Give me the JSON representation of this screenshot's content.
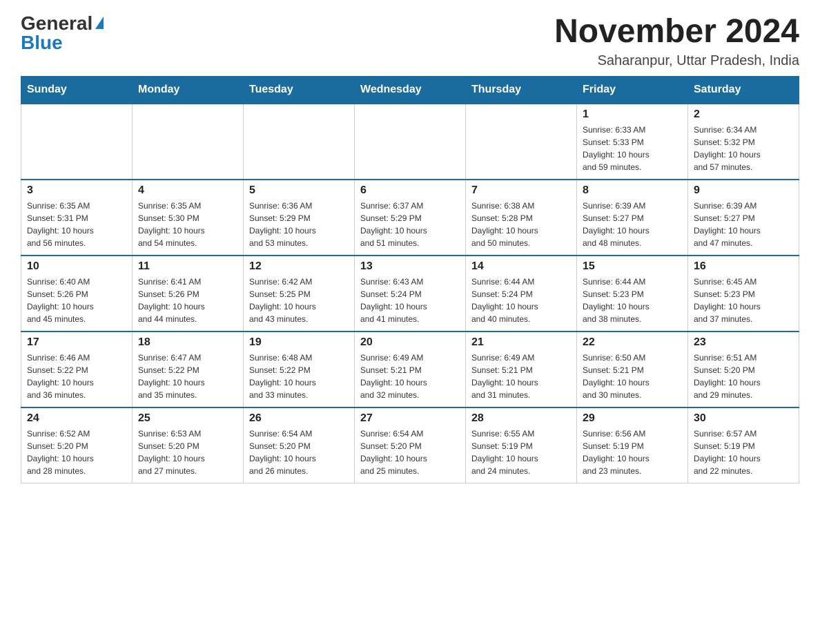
{
  "header": {
    "logo_general": "General",
    "logo_blue": "Blue",
    "month_title": "November 2024",
    "location": "Saharanpur, Uttar Pradesh, India"
  },
  "days_of_week": [
    "Sunday",
    "Monday",
    "Tuesday",
    "Wednesday",
    "Thursday",
    "Friday",
    "Saturday"
  ],
  "weeks": [
    [
      {
        "day": "",
        "info": ""
      },
      {
        "day": "",
        "info": ""
      },
      {
        "day": "",
        "info": ""
      },
      {
        "day": "",
        "info": ""
      },
      {
        "day": "",
        "info": ""
      },
      {
        "day": "1",
        "info": "Sunrise: 6:33 AM\nSunset: 5:33 PM\nDaylight: 10 hours\nand 59 minutes."
      },
      {
        "day": "2",
        "info": "Sunrise: 6:34 AM\nSunset: 5:32 PM\nDaylight: 10 hours\nand 57 minutes."
      }
    ],
    [
      {
        "day": "3",
        "info": "Sunrise: 6:35 AM\nSunset: 5:31 PM\nDaylight: 10 hours\nand 56 minutes."
      },
      {
        "day": "4",
        "info": "Sunrise: 6:35 AM\nSunset: 5:30 PM\nDaylight: 10 hours\nand 54 minutes."
      },
      {
        "day": "5",
        "info": "Sunrise: 6:36 AM\nSunset: 5:29 PM\nDaylight: 10 hours\nand 53 minutes."
      },
      {
        "day": "6",
        "info": "Sunrise: 6:37 AM\nSunset: 5:29 PM\nDaylight: 10 hours\nand 51 minutes."
      },
      {
        "day": "7",
        "info": "Sunrise: 6:38 AM\nSunset: 5:28 PM\nDaylight: 10 hours\nand 50 minutes."
      },
      {
        "day": "8",
        "info": "Sunrise: 6:39 AM\nSunset: 5:27 PM\nDaylight: 10 hours\nand 48 minutes."
      },
      {
        "day": "9",
        "info": "Sunrise: 6:39 AM\nSunset: 5:27 PM\nDaylight: 10 hours\nand 47 minutes."
      }
    ],
    [
      {
        "day": "10",
        "info": "Sunrise: 6:40 AM\nSunset: 5:26 PM\nDaylight: 10 hours\nand 45 minutes."
      },
      {
        "day": "11",
        "info": "Sunrise: 6:41 AM\nSunset: 5:26 PM\nDaylight: 10 hours\nand 44 minutes."
      },
      {
        "day": "12",
        "info": "Sunrise: 6:42 AM\nSunset: 5:25 PM\nDaylight: 10 hours\nand 43 minutes."
      },
      {
        "day": "13",
        "info": "Sunrise: 6:43 AM\nSunset: 5:24 PM\nDaylight: 10 hours\nand 41 minutes."
      },
      {
        "day": "14",
        "info": "Sunrise: 6:44 AM\nSunset: 5:24 PM\nDaylight: 10 hours\nand 40 minutes."
      },
      {
        "day": "15",
        "info": "Sunrise: 6:44 AM\nSunset: 5:23 PM\nDaylight: 10 hours\nand 38 minutes."
      },
      {
        "day": "16",
        "info": "Sunrise: 6:45 AM\nSunset: 5:23 PM\nDaylight: 10 hours\nand 37 minutes."
      }
    ],
    [
      {
        "day": "17",
        "info": "Sunrise: 6:46 AM\nSunset: 5:22 PM\nDaylight: 10 hours\nand 36 minutes."
      },
      {
        "day": "18",
        "info": "Sunrise: 6:47 AM\nSunset: 5:22 PM\nDaylight: 10 hours\nand 35 minutes."
      },
      {
        "day": "19",
        "info": "Sunrise: 6:48 AM\nSunset: 5:22 PM\nDaylight: 10 hours\nand 33 minutes."
      },
      {
        "day": "20",
        "info": "Sunrise: 6:49 AM\nSunset: 5:21 PM\nDaylight: 10 hours\nand 32 minutes."
      },
      {
        "day": "21",
        "info": "Sunrise: 6:49 AM\nSunset: 5:21 PM\nDaylight: 10 hours\nand 31 minutes."
      },
      {
        "day": "22",
        "info": "Sunrise: 6:50 AM\nSunset: 5:21 PM\nDaylight: 10 hours\nand 30 minutes."
      },
      {
        "day": "23",
        "info": "Sunrise: 6:51 AM\nSunset: 5:20 PM\nDaylight: 10 hours\nand 29 minutes."
      }
    ],
    [
      {
        "day": "24",
        "info": "Sunrise: 6:52 AM\nSunset: 5:20 PM\nDaylight: 10 hours\nand 28 minutes."
      },
      {
        "day": "25",
        "info": "Sunrise: 6:53 AM\nSunset: 5:20 PM\nDaylight: 10 hours\nand 27 minutes."
      },
      {
        "day": "26",
        "info": "Sunrise: 6:54 AM\nSunset: 5:20 PM\nDaylight: 10 hours\nand 26 minutes."
      },
      {
        "day": "27",
        "info": "Sunrise: 6:54 AM\nSunset: 5:20 PM\nDaylight: 10 hours\nand 25 minutes."
      },
      {
        "day": "28",
        "info": "Sunrise: 6:55 AM\nSunset: 5:19 PM\nDaylight: 10 hours\nand 24 minutes."
      },
      {
        "day": "29",
        "info": "Sunrise: 6:56 AM\nSunset: 5:19 PM\nDaylight: 10 hours\nand 23 minutes."
      },
      {
        "day": "30",
        "info": "Sunrise: 6:57 AM\nSunset: 5:19 PM\nDaylight: 10 hours\nand 22 minutes."
      }
    ]
  ]
}
